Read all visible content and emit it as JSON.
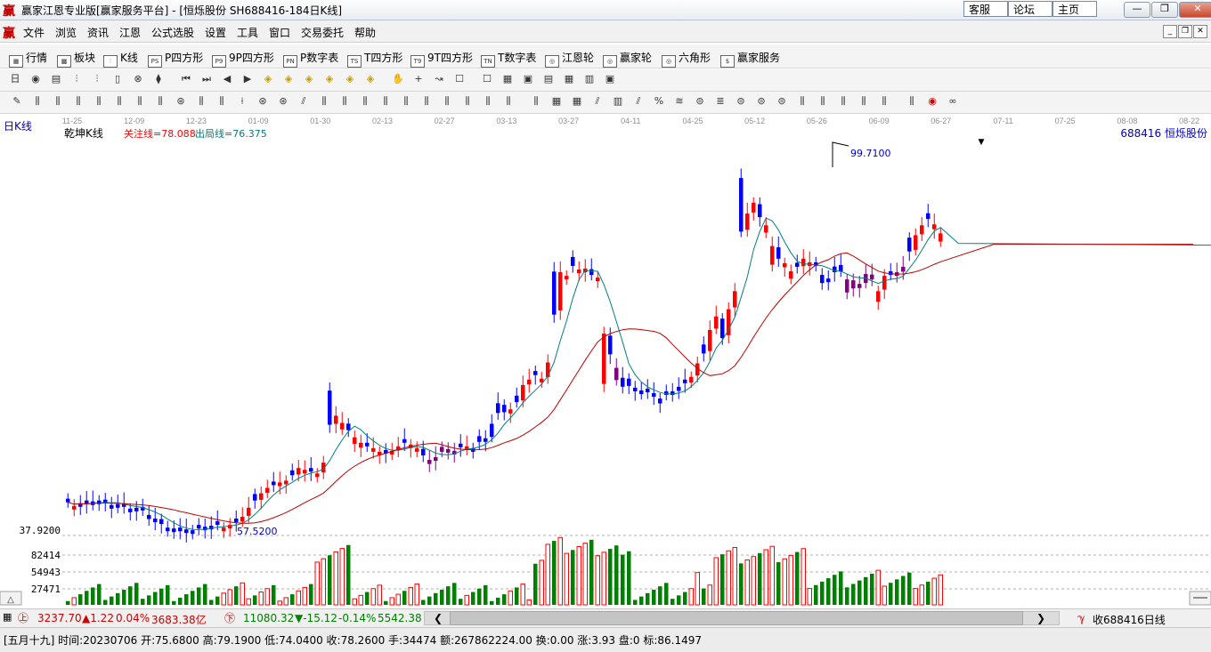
{
  "window": {
    "app_icon": "赢",
    "title": "赢家江恩专业版[赢家服务平台] - [恒烁股份   SH688416-184日K线]",
    "links": [
      "客服",
      "论坛",
      "主页"
    ],
    "controls": [
      "—",
      "❐",
      "✕"
    ]
  },
  "menu": {
    "icon": "赢",
    "items": [
      "文件",
      "浏览",
      "资讯",
      "江恩",
      "公式选股",
      "设置",
      "工具",
      "窗口",
      "交易委托",
      "帮助"
    ],
    "mdi_controls": [
      "_",
      "❐",
      "✕"
    ]
  },
  "nav": {
    "items": [
      {
        "icon": "table-icon",
        "glyph": "▦",
        "label": "行情"
      },
      {
        "icon": "grid-icon",
        "glyph": "▩",
        "label": "板块"
      },
      {
        "icon": "kline-icon",
        "glyph": "⫶",
        "label": "K线"
      },
      {
        "icon": "p-icon",
        "glyph": "PS",
        "label": "P四方形"
      },
      {
        "icon": "p9-icon",
        "glyph": "P9",
        "label": "9P四方形"
      },
      {
        "icon": "pn-icon",
        "glyph": "PN",
        "label": "P数字表"
      },
      {
        "icon": "ts-icon",
        "glyph": "TS",
        "label": "T四方形"
      },
      {
        "icon": "t9-icon",
        "glyph": "T9",
        "label": "9T四方形"
      },
      {
        "icon": "tn-icon",
        "glyph": "TN",
        "label": "T数字表"
      },
      {
        "icon": "gann-wheel-icon",
        "glyph": "◎",
        "label": "江恩轮"
      },
      {
        "icon": "winner-wheel-icon",
        "glyph": "◎",
        "label": "赢家轮"
      },
      {
        "icon": "hexagon-icon",
        "glyph": "◎",
        "label": "六角形"
      },
      {
        "icon": "dollar-icon",
        "glyph": "$",
        "label": "赢家服务"
      }
    ]
  },
  "chart": {
    "period_label": "日K线",
    "indicator_name": "乾坤K线",
    "focus_line": "关注线=78.088",
    "exit_line": "出局线=76.375",
    "stock_label": "688416  恒烁股份",
    "high_marker": "99.7100",
    "low_marker": "57.5200",
    "volume_labels": [
      "37.9200",
      "82414",
      "54943",
      "27471"
    ],
    "volume_bottom_label": "△",
    "dates": [
      "11-25",
      "12-09",
      "12-23",
      "01-09",
      "01-30",
      "02-13",
      "02-27",
      "03-13",
      "03-27",
      "04-11",
      "04-25",
      "05-12",
      "05-26",
      "06-09",
      "06-27",
      "07-11",
      "07-25",
      "08-08",
      "08-22"
    ],
    "colors": {
      "up": "#ff0000",
      "down": "#0000ff",
      "purple": "#800080",
      "vol_up": "#ff0000",
      "vol_down": "#008000",
      "ma_fast": "#008080",
      "ma_slow": "#c00000"
    }
  },
  "chart_data": {
    "type": "candlestick",
    "title": "乾坤K线",
    "series": [
      {
        "name": "关注线",
        "values": [
          78.088
        ]
      },
      {
        "name": "出局线",
        "values": [
          76.375
        ]
      }
    ],
    "price_high": 99.71,
    "price_low": 57.52,
    "volume_ticks": [
      27471,
      54943,
      82414
    ],
    "x": [
      "11-25",
      "12-09",
      "12-23",
      "01-09",
      "01-30",
      "02-13",
      "02-27",
      "03-13",
      "03-27",
      "04-11",
      "04-25",
      "05-12",
      "05-26",
      "06-09",
      "06-27",
      "07-11",
      "07-25",
      "08-08",
      "08-22"
    ]
  },
  "status": {
    "sh_index": "3237.70",
    "sh_change": "▲1.22",
    "sh_pct": "0.04%",
    "sh_amount": "3683.38亿",
    "sz_index": "11080.32",
    "sz_change": "▼-15.12",
    "sz_pct": "-0.14%",
    "sz_amount": "5542.38",
    "right_label": "收688416日线",
    "detail": "[五月十九] 时间:20230706 开:75.6800 高:79.1900 低:74.0400 收:78.2600 手:34474 额:267862224.00 换:0.00 涨:3.93 盘:0 标:86.1497"
  }
}
